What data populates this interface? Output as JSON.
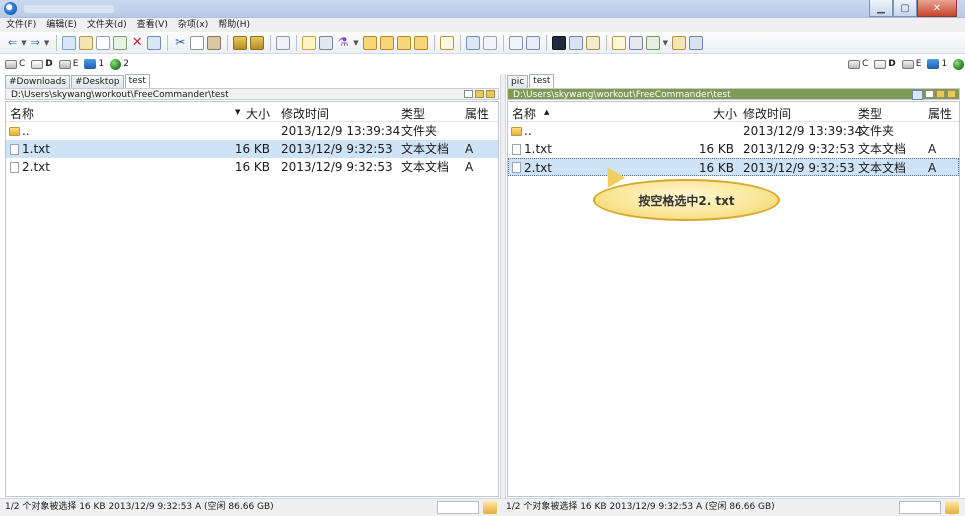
{
  "menu": [
    "文件(F)",
    "编辑(E)",
    "文件夹(d)",
    "查看(V)",
    "杂项(x)",
    "帮助(H)"
  ],
  "drives": [
    {
      "label": "C",
      "bold": false
    },
    {
      "label": "D",
      "bold": true
    },
    {
      "label": "E",
      "bold": false
    },
    {
      "label": "1",
      "bold": false
    },
    {
      "label": "2",
      "bold": false
    }
  ],
  "left": {
    "tabs": [
      "#Downloads",
      "#Desktop",
      "test"
    ],
    "active_tab": 2,
    "path": "D:\\Users\\skywang\\workout\\FreeCommander\\test",
    "columns": {
      "name": "名称",
      "size": "大小",
      "date": "修改时间",
      "type": "类型",
      "attr": "属性"
    },
    "sort_marker": "▼",
    "rows": [
      {
        "name": "..",
        "size": "",
        "date": "2013/12/9 13:39:34",
        "type": "文件夹",
        "attr": "",
        "kind": "folder"
      },
      {
        "name": "1.txt",
        "size": "16 KB",
        "date": "2013/12/9 9:32:53",
        "type": "文本文档",
        "attr": "A",
        "kind": "file"
      },
      {
        "name": "2.txt",
        "size": "16 KB",
        "date": "2013/12/9 9:32:53",
        "type": "文本文档",
        "attr": "A",
        "kind": "file"
      }
    ],
    "status": "1/2 个对象被选择  16 KB  2013/12/9 9:32:53  A  (空闲 86.66 GB)"
  },
  "right": {
    "tabs": [
      "pic",
      "test"
    ],
    "active_tab": 1,
    "path": "D:\\Users\\skywang\\workout\\FreeCommander\\test",
    "columns": {
      "name": "名称",
      "size": "大小",
      "date": "修改时间",
      "type": "类型",
      "attr": "属性"
    },
    "sort_marker": "▲",
    "rows": [
      {
        "name": "..",
        "size": "",
        "date": "2013/12/9 13:39:34",
        "type": "文件夹",
        "attr": "",
        "kind": "folder"
      },
      {
        "name": "1.txt",
        "size": "16 KB",
        "date": "2013/12/9 9:32:53",
        "type": "文本文档",
        "attr": "A",
        "kind": "file"
      },
      {
        "name": "2.txt",
        "size": "16 KB",
        "date": "2013/12/9 9:32:53",
        "type": "文本文档",
        "attr": "A",
        "kind": "file"
      }
    ],
    "status": "1/2 个对象被选择  16 KB  2013/12/9 9:32:53  A  (空闲 86.66 GB)"
  },
  "callout": "按空格选中2. txt",
  "colors": {
    "path_active": "#7e9a55",
    "selection": "#cfe3f7",
    "callout_fill": "#fbe79b"
  }
}
